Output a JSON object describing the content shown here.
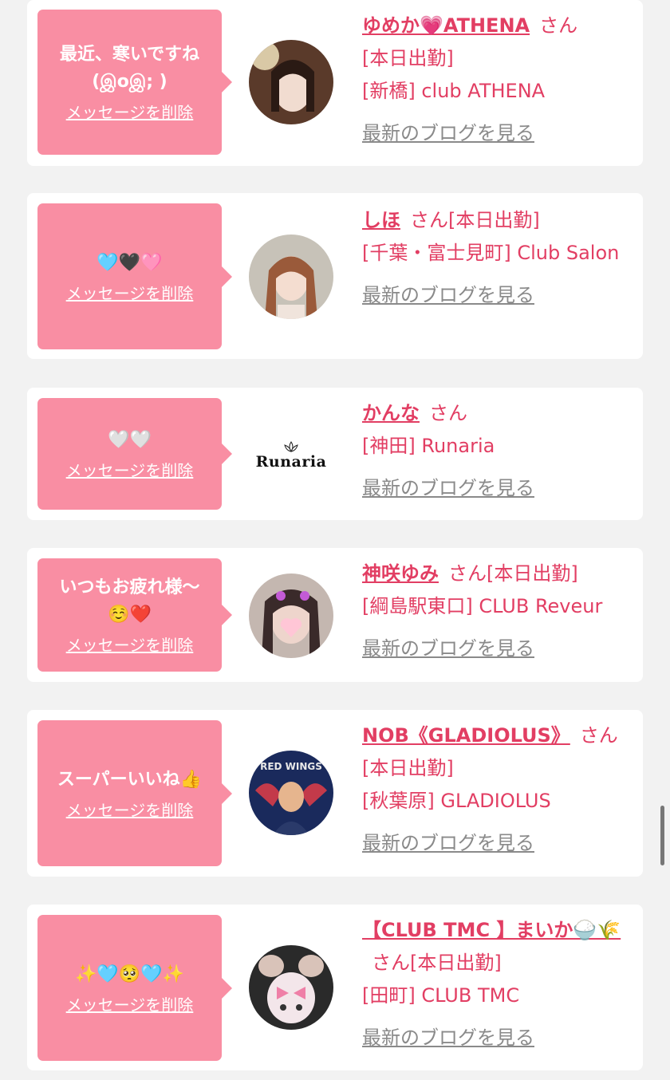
{
  "cards": [
    {
      "message": "最近、寒いですね(இoஇ; )",
      "delete_label": "メッセージを削除",
      "name": "ゆめか💗ATHENA",
      "san": "さん",
      "line2": "[本日出勤]",
      "line3": "[新橋] club ATHENA",
      "blog_label": "最新のブログを見る"
    },
    {
      "message": "🩵🖤🩷",
      "delete_label": "メッセージを削除",
      "name": "しほ",
      "san": "さん[本日出勤]",
      "line2": "[千葉・富士見町] Club Salon",
      "blog_label": "最新のブログを見る"
    },
    {
      "message": "🤍🤍",
      "delete_label": "メッセージを削除",
      "name": "かんな",
      "san": "さん",
      "line2": "[神田] Runaria",
      "blog_label": "最新のブログを見る",
      "logo_text": "Runaria"
    },
    {
      "message": "いつもお疲れ様〜☺️❤️",
      "delete_label": "メッセージを削除",
      "name": "神咲ゆみ",
      "san": "さん[本日出勤]",
      "line2": "[綱島駅東口] CLUB Reveur",
      "blog_label": "最新のブログを見る"
    },
    {
      "message": "スーパーいいね👍",
      "delete_label": "メッセージを削除",
      "name": "NOB《GLADIOLUS》",
      "san": "さん[本日出勤]",
      "line2": "[秋葉原] GLADIOLUS",
      "blog_label": "最新のブログを見る",
      "avatar_text": "RED WINGS"
    },
    {
      "message": "✨🩵🥺🩵✨",
      "delete_label": "メッセージを削除",
      "name": "【CLUB TMC 】まいか🍚🌾",
      "san": "さん[本日出勤]",
      "line2": "[田町] CLUB TMC",
      "blog_label": "最新のブログを見る"
    }
  ],
  "colors": {
    "bubble": "#f98ea3",
    "accent": "#e23e63",
    "muted": "#8a8a8a",
    "background": "#f2f2f2"
  }
}
